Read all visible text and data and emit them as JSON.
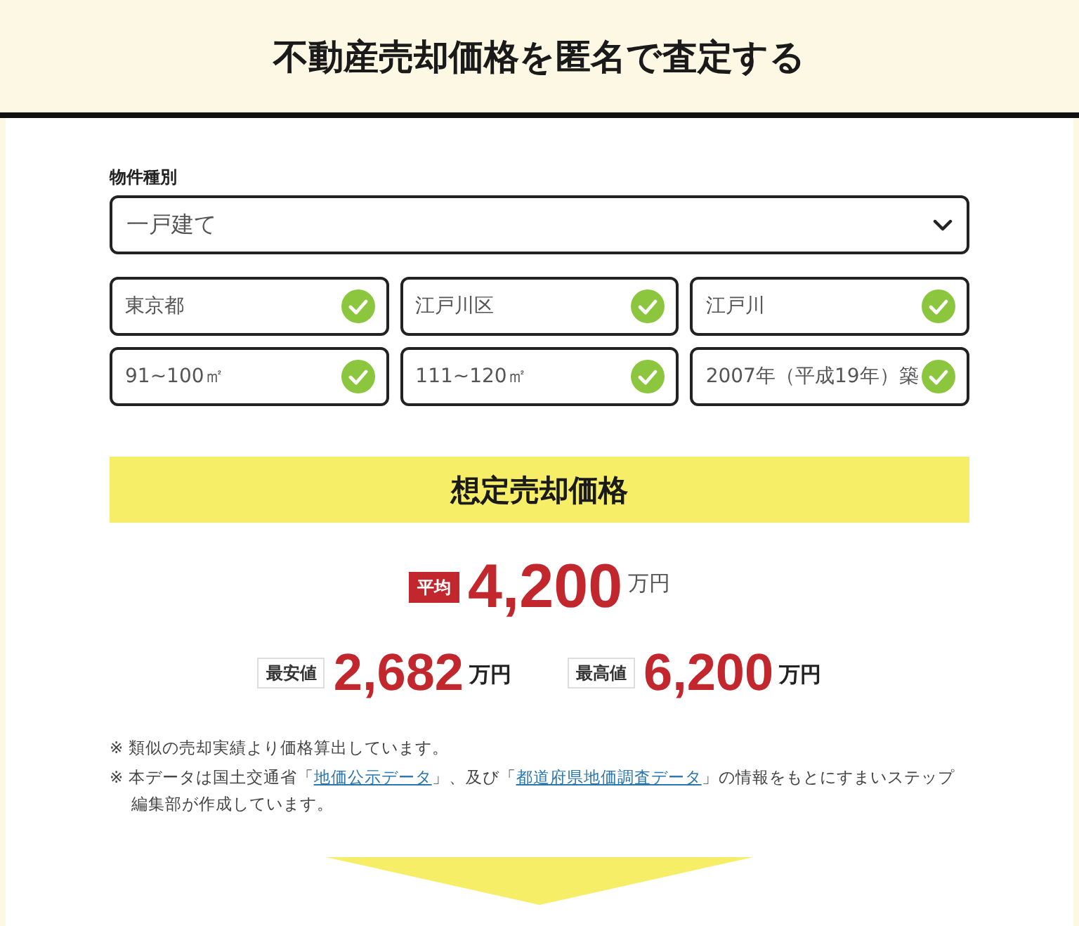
{
  "header": {
    "title": "不動産売却価格を匿名で査定する"
  },
  "property_type": {
    "label": "物件種別",
    "value": "一戸建て"
  },
  "conditions": [
    {
      "value": "東京都",
      "checked": true
    },
    {
      "value": "江戸川区",
      "checked": true
    },
    {
      "value": "江戸川",
      "checked": true
    },
    {
      "value": "91~100㎡",
      "checked": true
    },
    {
      "value": "111~120㎡",
      "checked": true
    },
    {
      "value": "2007年（平成19年）築",
      "checked": true
    }
  ],
  "result": {
    "heading": "想定売却価格",
    "average": {
      "badge": "平均",
      "amount": "4,200",
      "unit": "万円"
    },
    "range": [
      {
        "badge": "最安値",
        "amount": "2,682",
        "unit": "万円"
      },
      {
        "badge": "最高値",
        "amount": "6,200",
        "unit": "万円"
      }
    ]
  },
  "notes": [
    {
      "parts": [
        {
          "kind": "text",
          "text": "※ 類似の売却実績より価格算出しています。"
        }
      ]
    },
    {
      "parts": [
        {
          "kind": "text",
          "text": "※ 本データは国土交通省「"
        },
        {
          "kind": "link",
          "text": "地価公示データ"
        },
        {
          "kind": "text",
          "text": "」、及び「"
        },
        {
          "kind": "link",
          "text": "都道府県地価調査データ"
        },
        {
          "kind": "text",
          "text": "」の情報をもとにすまいステップ編集部が作成しています。"
        }
      ]
    }
  ]
}
